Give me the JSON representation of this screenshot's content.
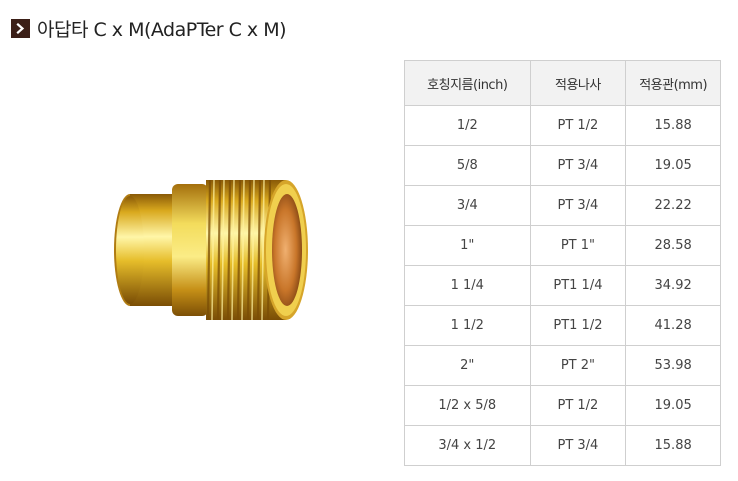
{
  "title": {
    "icon": "chevron-right-icon",
    "text": "아답타 C x M(AdaPTer C x M)",
    "icon_color": "#3b1f17"
  },
  "product": {
    "image_name": "brass-adapter-fitting",
    "colors": {
      "brass_light": "#f7e36a",
      "brass_mid": "#d9a91e",
      "brass_dark": "#8a5a07"
    }
  },
  "table": {
    "headers": [
      "호칭지름(inch)",
      "적용나사",
      "적용관(mm)"
    ],
    "rows": [
      [
        "1/2",
        "PT 1/2",
        "15.88"
      ],
      [
        "5/8",
        "PT 3/4",
        "19.05"
      ],
      [
        "3/4",
        "PT 3/4",
        "22.22"
      ],
      [
        "1\"",
        "PT 1\"",
        "28.58"
      ],
      [
        "1 1/4",
        "PT1 1/4",
        "34.92"
      ],
      [
        "1 1/2",
        "PT1 1/2",
        "41.28"
      ],
      [
        "2\"",
        "PT 2\"",
        "53.98"
      ],
      [
        "1/2 x 5/8",
        "PT 1/2",
        "19.05"
      ],
      [
        "3/4 x 1/2",
        "PT 3/4",
        "15.88"
      ]
    ]
  }
}
